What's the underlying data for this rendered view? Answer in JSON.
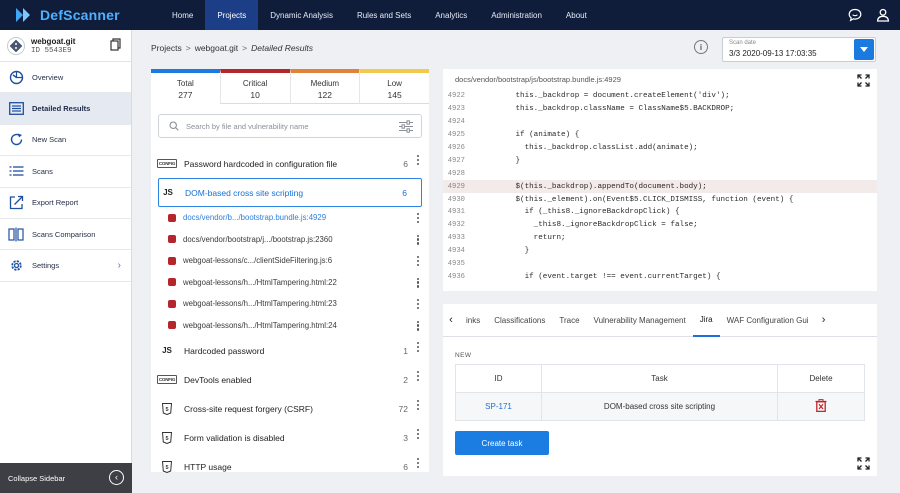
{
  "app": {
    "brand": "DefScanner"
  },
  "nav": {
    "items": [
      "Home",
      "Projects",
      "Dynamic Analysis",
      "Rules and Sets",
      "Analytics",
      "Administration",
      "About"
    ],
    "active": "Projects"
  },
  "project": {
    "name": "webgoat.git",
    "id": "ID 5543E9"
  },
  "sidebar": {
    "items": [
      {
        "label": "Overview",
        "icon": "overview-icon"
      },
      {
        "label": "Detailed Results",
        "icon": "list-icon"
      },
      {
        "label": "New Scan",
        "icon": "refresh-icon"
      },
      {
        "label": "Scans",
        "icon": "scans-icon"
      },
      {
        "label": "Export Report",
        "icon": "export-icon"
      },
      {
        "label": "Scans Comparison",
        "icon": "compare-icon"
      },
      {
        "label": "Settings",
        "icon": "gear-icon"
      }
    ],
    "collapse_label": "Collapse Sidebar"
  },
  "breadcrumb": {
    "root": "Projects",
    "project": "webgoat.git",
    "current": "Detailed Results"
  },
  "scan_date": {
    "label": "Scan date",
    "value": "3/3 2020-09-13 17:03:35"
  },
  "severity_tabs": [
    {
      "label": "Total",
      "count": "277",
      "color": "#1f7ae0"
    },
    {
      "label": "Critical",
      "count": "10",
      "color": "#b3262c"
    },
    {
      "label": "Medium",
      "count": "122",
      "color": "#e0823a"
    },
    {
      "label": "Low",
      "count": "145",
      "color": "#f2c94c"
    }
  ],
  "search": {
    "placeholder": "Search by file and vulnerability name"
  },
  "vulns": {
    "v1": {
      "name": "Password hardcoded in configuration file",
      "count": "6",
      "icon": "CONFIG"
    },
    "v2": {
      "name": "DOM-based cross site scripting",
      "count": "6",
      "icon": "JS"
    },
    "files": [
      "docs/vendor/b.../bootstrap.bundle.js:4929",
      "docs/vendor/bootstrap/j.../bootstrap.js:2360",
      "webgoat-lessons/c.../clientSideFiltering.js:6",
      "webgoat-lessons/h.../HtmlTampering.html:22",
      "webgoat-lessons/h.../HtmlTampering.html:23",
      "webgoat-lessons/h.../HtmlTampering.html:24"
    ],
    "v3": {
      "name": "Hardcoded password",
      "count": "1",
      "icon": "JS"
    },
    "v4": {
      "name": "DevTools enabled",
      "count": "2",
      "icon": "CONFIG"
    },
    "v5": {
      "name": "Cross-site request forgery (CSRF)",
      "count": "72",
      "icon": "html5-icon"
    },
    "v6": {
      "name": "Form validation is disabled",
      "count": "3",
      "icon": "html5-icon"
    },
    "v7": {
      "name": "HTTP usage",
      "count": "6",
      "icon": "html5-icon"
    }
  },
  "code": {
    "path": "docs/vendor/bootstrap/js/bootstrap.bundle.js:4929",
    "lines": [
      {
        "n": "4922",
        "t": "        this._backdrop = document.createElement('div');"
      },
      {
        "n": "4923",
        "t": "        this._backdrop.className = ClassName$5.BACKDROP;"
      },
      {
        "n": "4924",
        "t": ""
      },
      {
        "n": "4925",
        "t": "        if (animate) {"
      },
      {
        "n": "4926",
        "t": "          this._backdrop.classList.add(animate);"
      },
      {
        "n": "4927",
        "t": "        }"
      },
      {
        "n": "4928",
        "t": ""
      },
      {
        "n": "4929",
        "t": "        $(this._backdrop).appendTo(document.body);"
      },
      {
        "n": "4930",
        "t": "        $(this._element).on(Event$5.CLICK_DISMISS, function (event) {"
      },
      {
        "n": "4931",
        "t": "          if (_this8._ignoreBackdropClick) {"
      },
      {
        "n": "4932",
        "t": "            _this8._ignoreBackdropClick = false;"
      },
      {
        "n": "4933",
        "t": "            return;"
      },
      {
        "n": "4934",
        "t": "          }"
      },
      {
        "n": "4935",
        "t": ""
      },
      {
        "n": "4936",
        "t": "          if (event.target !== event.currentTarget) {"
      }
    ],
    "highlight_line": "4929"
  },
  "detail_tabs": [
    "Links",
    "Classifications",
    "Trace",
    "Vulnerability Management",
    "Jira",
    "WAF Configuration Guide"
  ],
  "detail_tabs_visible": [
    "inks",
    "Classifications",
    "Trace",
    "Vulnerability Management",
    "Jira",
    "WAF Configuration Gui"
  ],
  "jira": {
    "new_label": "NEW",
    "headers": {
      "id": "ID",
      "task": "Task",
      "delete": "Delete"
    },
    "rows": [
      {
        "id": "SP-171",
        "task": "DOM-based cross site scripting"
      }
    ],
    "create_label": "Create task"
  }
}
